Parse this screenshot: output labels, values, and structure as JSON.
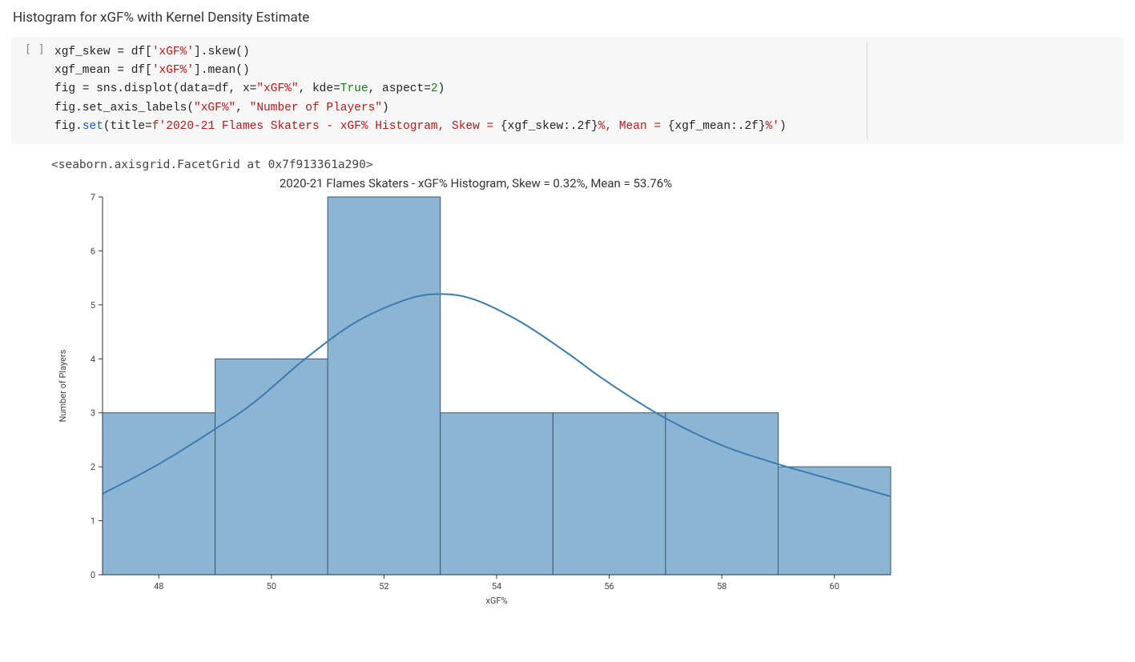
{
  "section_title": "Histogram for xGF% with Kernel Density Estimate",
  "cell_prompt": "[ ]",
  "code": {
    "l1_a": "xgf_skew = df[",
    "l1_str": "'xGF%'",
    "l1_b": "].skew()",
    "l2_a": "xgf_mean = df[",
    "l2_str": "'xGF%'",
    "l2_b": "].mean()",
    "l3_a": "fig = sns.displot(data=df, x=",
    "l3_str": "\"xGF%\"",
    "l3_b": ", kde=",
    "l3_true": "True",
    "l3_c": ", aspect=",
    "l3_num": "2",
    "l3_d": ")",
    "l4_a": "fig.set_axis_labels(",
    "l4_s1": "\"xGF%\"",
    "l4_b": ", ",
    "l4_s2": "\"Number of Players\"",
    "l4_c": ")",
    "l5_a": "fig.",
    "l5_set": "set",
    "l5_b": "(title=",
    "l5_f1": "f'2020-21 Flames Skaters - xGF% Histogram, Skew = ",
    "l5_e1": "{xgf_skew:.2f}",
    "l5_f2": "%, Mean = ",
    "l5_e2": "{xgf_mean:.2f}",
    "l5_f3": "%'",
    "l5_c": ")"
  },
  "output_repr": "<seaborn.axisgrid.FacetGrid at 0x7f913361a290>",
  "chart_data": {
    "type": "bar",
    "title": "2020-21 Flames Skaters - xGF% Histogram, Skew = 0.32%, Mean = 53.76%",
    "xlabel": "xGF%",
    "ylabel": "Number of Players",
    "bin_width": 2,
    "bin_edges": [
      47,
      49,
      51,
      53,
      55,
      57,
      59,
      61
    ],
    "values": [
      3,
      4,
      7,
      3,
      3,
      3,
      2
    ],
    "x_ticks": [
      48,
      50,
      52,
      54,
      56,
      58,
      60
    ],
    "y_ticks": [
      0,
      1,
      2,
      3,
      4,
      5,
      6,
      7
    ],
    "ylim": [
      0,
      7
    ],
    "xlim": [
      47,
      61
    ],
    "kde": [
      {
        "x": 47.0,
        "y": 1.5
      },
      {
        "x": 48.0,
        "y": 2.05
      },
      {
        "x": 49.0,
        "y": 2.7
      },
      {
        "x": 49.7,
        "y": 3.2
      },
      {
        "x": 50.6,
        "y": 4.0
      },
      {
        "x": 51.5,
        "y": 4.68
      },
      {
        "x": 52.4,
        "y": 5.1
      },
      {
        "x": 53.0,
        "y": 5.2
      },
      {
        "x": 53.6,
        "y": 5.1
      },
      {
        "x": 54.4,
        "y": 4.7
      },
      {
        "x": 55.2,
        "y": 4.15
      },
      {
        "x": 56.0,
        "y": 3.55
      },
      {
        "x": 57.0,
        "y": 2.9
      },
      {
        "x": 58.0,
        "y": 2.4
      },
      {
        "x": 59.0,
        "y": 2.05
      },
      {
        "x": 60.0,
        "y": 1.75
      },
      {
        "x": 61.0,
        "y": 1.45
      }
    ]
  }
}
